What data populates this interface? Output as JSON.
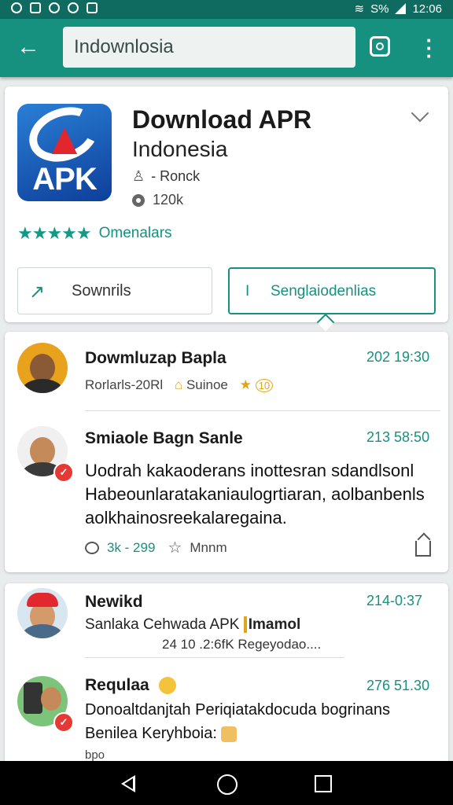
{
  "status_bar": {
    "time": "12:06",
    "battery": "S%"
  },
  "toolbar": {
    "search_value": "Indownlosia"
  },
  "app": {
    "logo_text": "APK",
    "title": "Download APR",
    "subtitle": "Indonesia",
    "developer": "- Ronck",
    "size": "120k",
    "stars": "★★★★★",
    "rating_text": "Omenalars"
  },
  "buttons": {
    "left_label": "Sownrils",
    "right_label": "Senglaiodenlias"
  },
  "comments": [
    {
      "name": "Dowmluzap Bapla",
      "time": "202 19:30",
      "meta_left": "Rorlarls-20Rl",
      "meta_mid": "Suinoe",
      "meta_badge": "10"
    },
    {
      "name": "Smiaole Bagn Sanle",
      "time": "213 58:50",
      "text_lines": [
        "Uodrah kakaoderans inottesran sdandlsonl",
        "Habeounlaratakaniaulogrtiaran, aolbanbenls",
        "aolkhainosreekalaregaina."
      ],
      "reactions": "3k - 299",
      "shares": "Mnnm"
    },
    {
      "name": "Newikd",
      "time": "214-0:37",
      "line1": "Sanlaka Cehwada APK",
      "line1_tag": "Imamol",
      "line2": "24 10 .2:6fK Regeyodao...."
    },
    {
      "name": "Requlaa",
      "time": "276 51.30",
      "line1": "Donoaltdanjtah Periqiatakdocuda bogrinans",
      "line2": "Benilea Keryhboia:",
      "line3": "bpo"
    }
  ]
}
